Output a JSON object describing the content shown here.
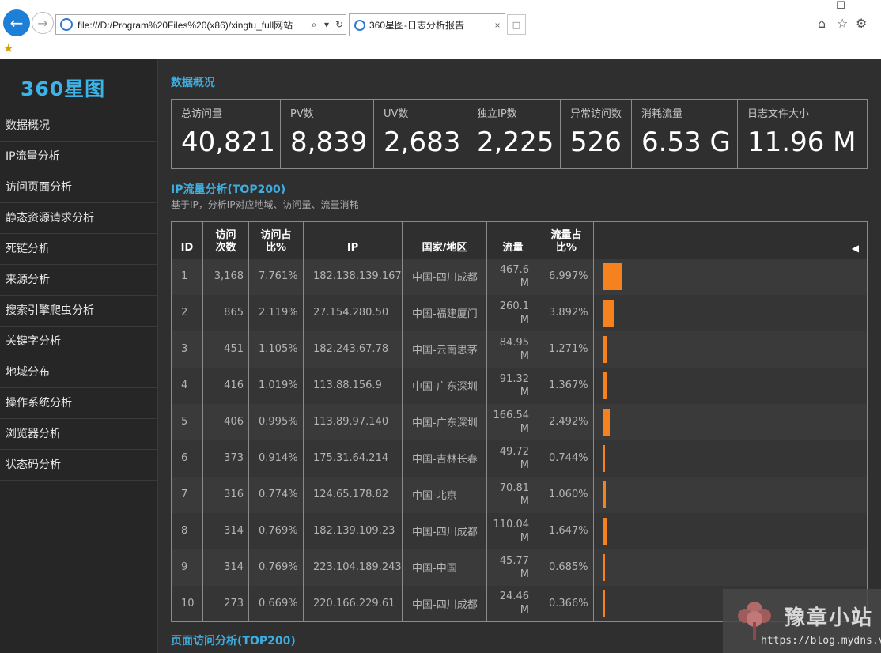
{
  "browser": {
    "url": "file:///D:/Program%20Files%20(x86)/xingtu_full网站",
    "tab_title": "360星图-日志分析报告",
    "back_icon": "←",
    "forward_icon": "→",
    "search_icon": "⌕",
    "dropdown_icon": "▾",
    "refresh_icon": "↻",
    "close_tab_icon": "×",
    "minimize_icon": "—",
    "maximize_icon": "☐",
    "home_icon": "⌂",
    "favorites_icon": "☆",
    "settings_icon": "⚙",
    "favorites_bar_icon": "★"
  },
  "sidebar": {
    "logo": "360星图",
    "items": [
      {
        "label": "数据概况"
      },
      {
        "label": "IP流量分析"
      },
      {
        "label": "访问页面分析"
      },
      {
        "label": "静态资源请求分析"
      },
      {
        "label": "死链分析"
      },
      {
        "label": "来源分析"
      },
      {
        "label": "搜索引擎爬虫分析"
      },
      {
        "label": "关键字分析"
      },
      {
        "label": "地域分布"
      },
      {
        "label": "操作系统分析"
      },
      {
        "label": "浏览器分析"
      },
      {
        "label": "状态码分析"
      }
    ]
  },
  "overview": {
    "title": "数据概况",
    "stats": [
      {
        "label": "总访问量",
        "value": "40,821"
      },
      {
        "label": "PV数",
        "value": "8,839"
      },
      {
        "label": "UV数",
        "value": "2,683"
      },
      {
        "label": "独立IP数",
        "value": "2,225"
      },
      {
        "label": "异常访问数",
        "value": "526"
      },
      {
        "label": "消耗流量",
        "value": "6.53 G"
      },
      {
        "label": "日志文件大小",
        "value": "11.96 M"
      }
    ]
  },
  "ip_analysis": {
    "title": "IP流量分析(TOP200)",
    "subtitle": "基于IP，分析IP对应地域、访问量、流量消耗",
    "headers": {
      "id": "ID",
      "visits_1": "访问",
      "visits_2": "次数",
      "share_1": "访问占",
      "share_2": "比%",
      "ip": "IP",
      "region": "国家/地区",
      "flow": "流量",
      "flow_share_1": "流量占",
      "flow_share_2": "比%",
      "collapse_icon": "◀"
    },
    "rows": [
      {
        "id": "1",
        "visits": "3,168",
        "share": "7.761%",
        "ip": "182.138.139.167",
        "region": "中国-四川成都",
        "flow_num": "467.6",
        "flow_unit": "M",
        "flow_share": "6.997%",
        "flow_pct": 6.997
      },
      {
        "id": "2",
        "visits": "865",
        "share": "2.119%",
        "ip": "27.154.280.50",
        "region": "中国-福建厦门",
        "flow_num": "260.1",
        "flow_unit": "M",
        "flow_share": "3.892%",
        "flow_pct": 3.892
      },
      {
        "id": "3",
        "visits": "451",
        "share": "1.105%",
        "ip": "182.243.67.78",
        "region": "中国-云南思茅",
        "flow_num": "84.95",
        "flow_unit": "M",
        "flow_share": "1.271%",
        "flow_pct": 1.271
      },
      {
        "id": "4",
        "visits": "416",
        "share": "1.019%",
        "ip": "113.88.156.9",
        "region": "中国-广东深圳",
        "flow_num": "91.32",
        "flow_unit": "M",
        "flow_share": "1.367%",
        "flow_pct": 1.367
      },
      {
        "id": "5",
        "visits": "406",
        "share": "0.995%",
        "ip": "113.89.97.140",
        "region": "中国-广东深圳",
        "flow_num": "166.54",
        "flow_unit": "M",
        "flow_share": "2.492%",
        "flow_pct": 2.492
      },
      {
        "id": "6",
        "visits": "373",
        "share": "0.914%",
        "ip": "175.31.64.214",
        "region": "中国-吉林长春",
        "flow_num": "49.72",
        "flow_unit": "M",
        "flow_share": "0.744%",
        "flow_pct": 0.744
      },
      {
        "id": "7",
        "visits": "316",
        "share": "0.774%",
        "ip": "124.65.178.82",
        "region": "中国-北京",
        "flow_num": "70.81",
        "flow_unit": "M",
        "flow_share": "1.060%",
        "flow_pct": 1.06
      },
      {
        "id": "8",
        "visits": "314",
        "share": "0.769%",
        "ip": "182.139.109.23",
        "region": "中国-四川成都",
        "flow_num": "110.04",
        "flow_unit": "M",
        "flow_share": "1.647%",
        "flow_pct": 1.647
      },
      {
        "id": "9",
        "visits": "314",
        "share": "0.769%",
        "ip": "223.104.189.243",
        "region": "中国-中国",
        "flow_num": "45.77",
        "flow_unit": "M",
        "flow_share": "0.685%",
        "flow_pct": 0.685
      },
      {
        "id": "10",
        "visits": "273",
        "share": "0.669%",
        "ip": "220.166.229.61",
        "region": "中国-四川成都",
        "flow_num": "24.46",
        "flow_unit": "M",
        "flow_share": "0.366%",
        "flow_pct": 0.366
      }
    ]
  },
  "page_analysis": {
    "title": "页面访问分析(TOP200)"
  },
  "watermark": {
    "title": "豫章小站",
    "url": "https://blog.mydns.vip"
  },
  "colors": {
    "accent": "#3eaee0",
    "bar": "#f5821f",
    "background": "#2f2f2f",
    "sidebar": "#262626"
  }
}
